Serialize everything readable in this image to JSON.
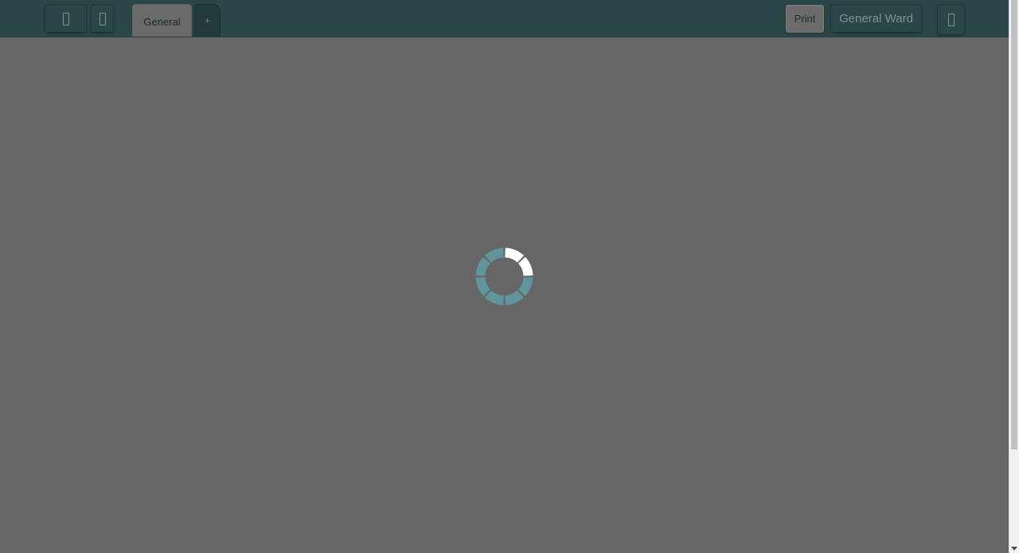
{
  "toolbar": {
    "menu_button_icon": "menu-icon",
    "page_button_icon": "page-icon",
    "tabs": [
      {
        "label": "General",
        "active": true
      },
      {
        "label": "+",
        "active": false
      }
    ],
    "print_label": "Print",
    "ward_label": "General Ward",
    "user_button_icon": "user-icon"
  },
  "loading": {
    "icon": "loading-spinner-icon",
    "active_color": "#ffffff",
    "inactive_color": "#5f959b"
  },
  "colors": {
    "toolbar_bg": "#2a4646",
    "overlay_bg": "#666666"
  }
}
